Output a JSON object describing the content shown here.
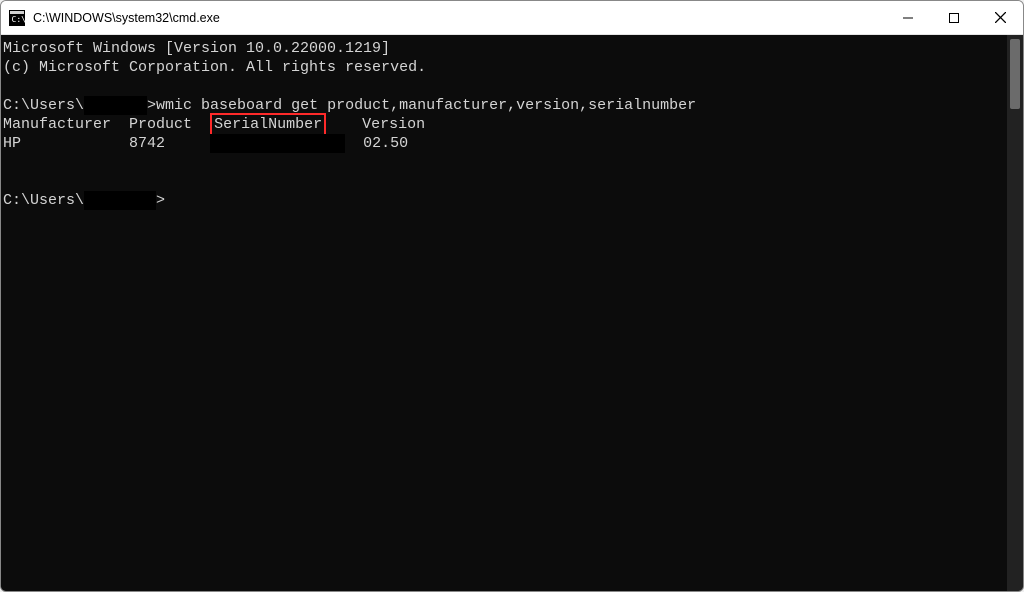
{
  "window": {
    "title": "C:\\WINDOWS\\system32\\cmd.exe"
  },
  "terminal": {
    "header1": "Microsoft Windows [Version 10.0.22000.1219]",
    "header2": "(c) Microsoft Corporation. All rights reserved.",
    "prompt_prefix": "C:\\Users\\",
    "prompt_redacted": "       ",
    "prompt_cursor": ">",
    "command": "wmic baseboard get product,manufacturer,version,serialnumber",
    "columns": {
      "manufacturer": "Manufacturer",
      "product": "Product",
      "serialnumber": "SerialNumber",
      "version": "Version"
    },
    "row": {
      "manufacturer": "HP",
      "product": "8742",
      "serial_redacted": "               ",
      "version": "02.50"
    },
    "prompt2_prefix": "C:\\Users\\",
    "prompt2_redacted": "        ",
    "prompt2_cursor": ">"
  }
}
